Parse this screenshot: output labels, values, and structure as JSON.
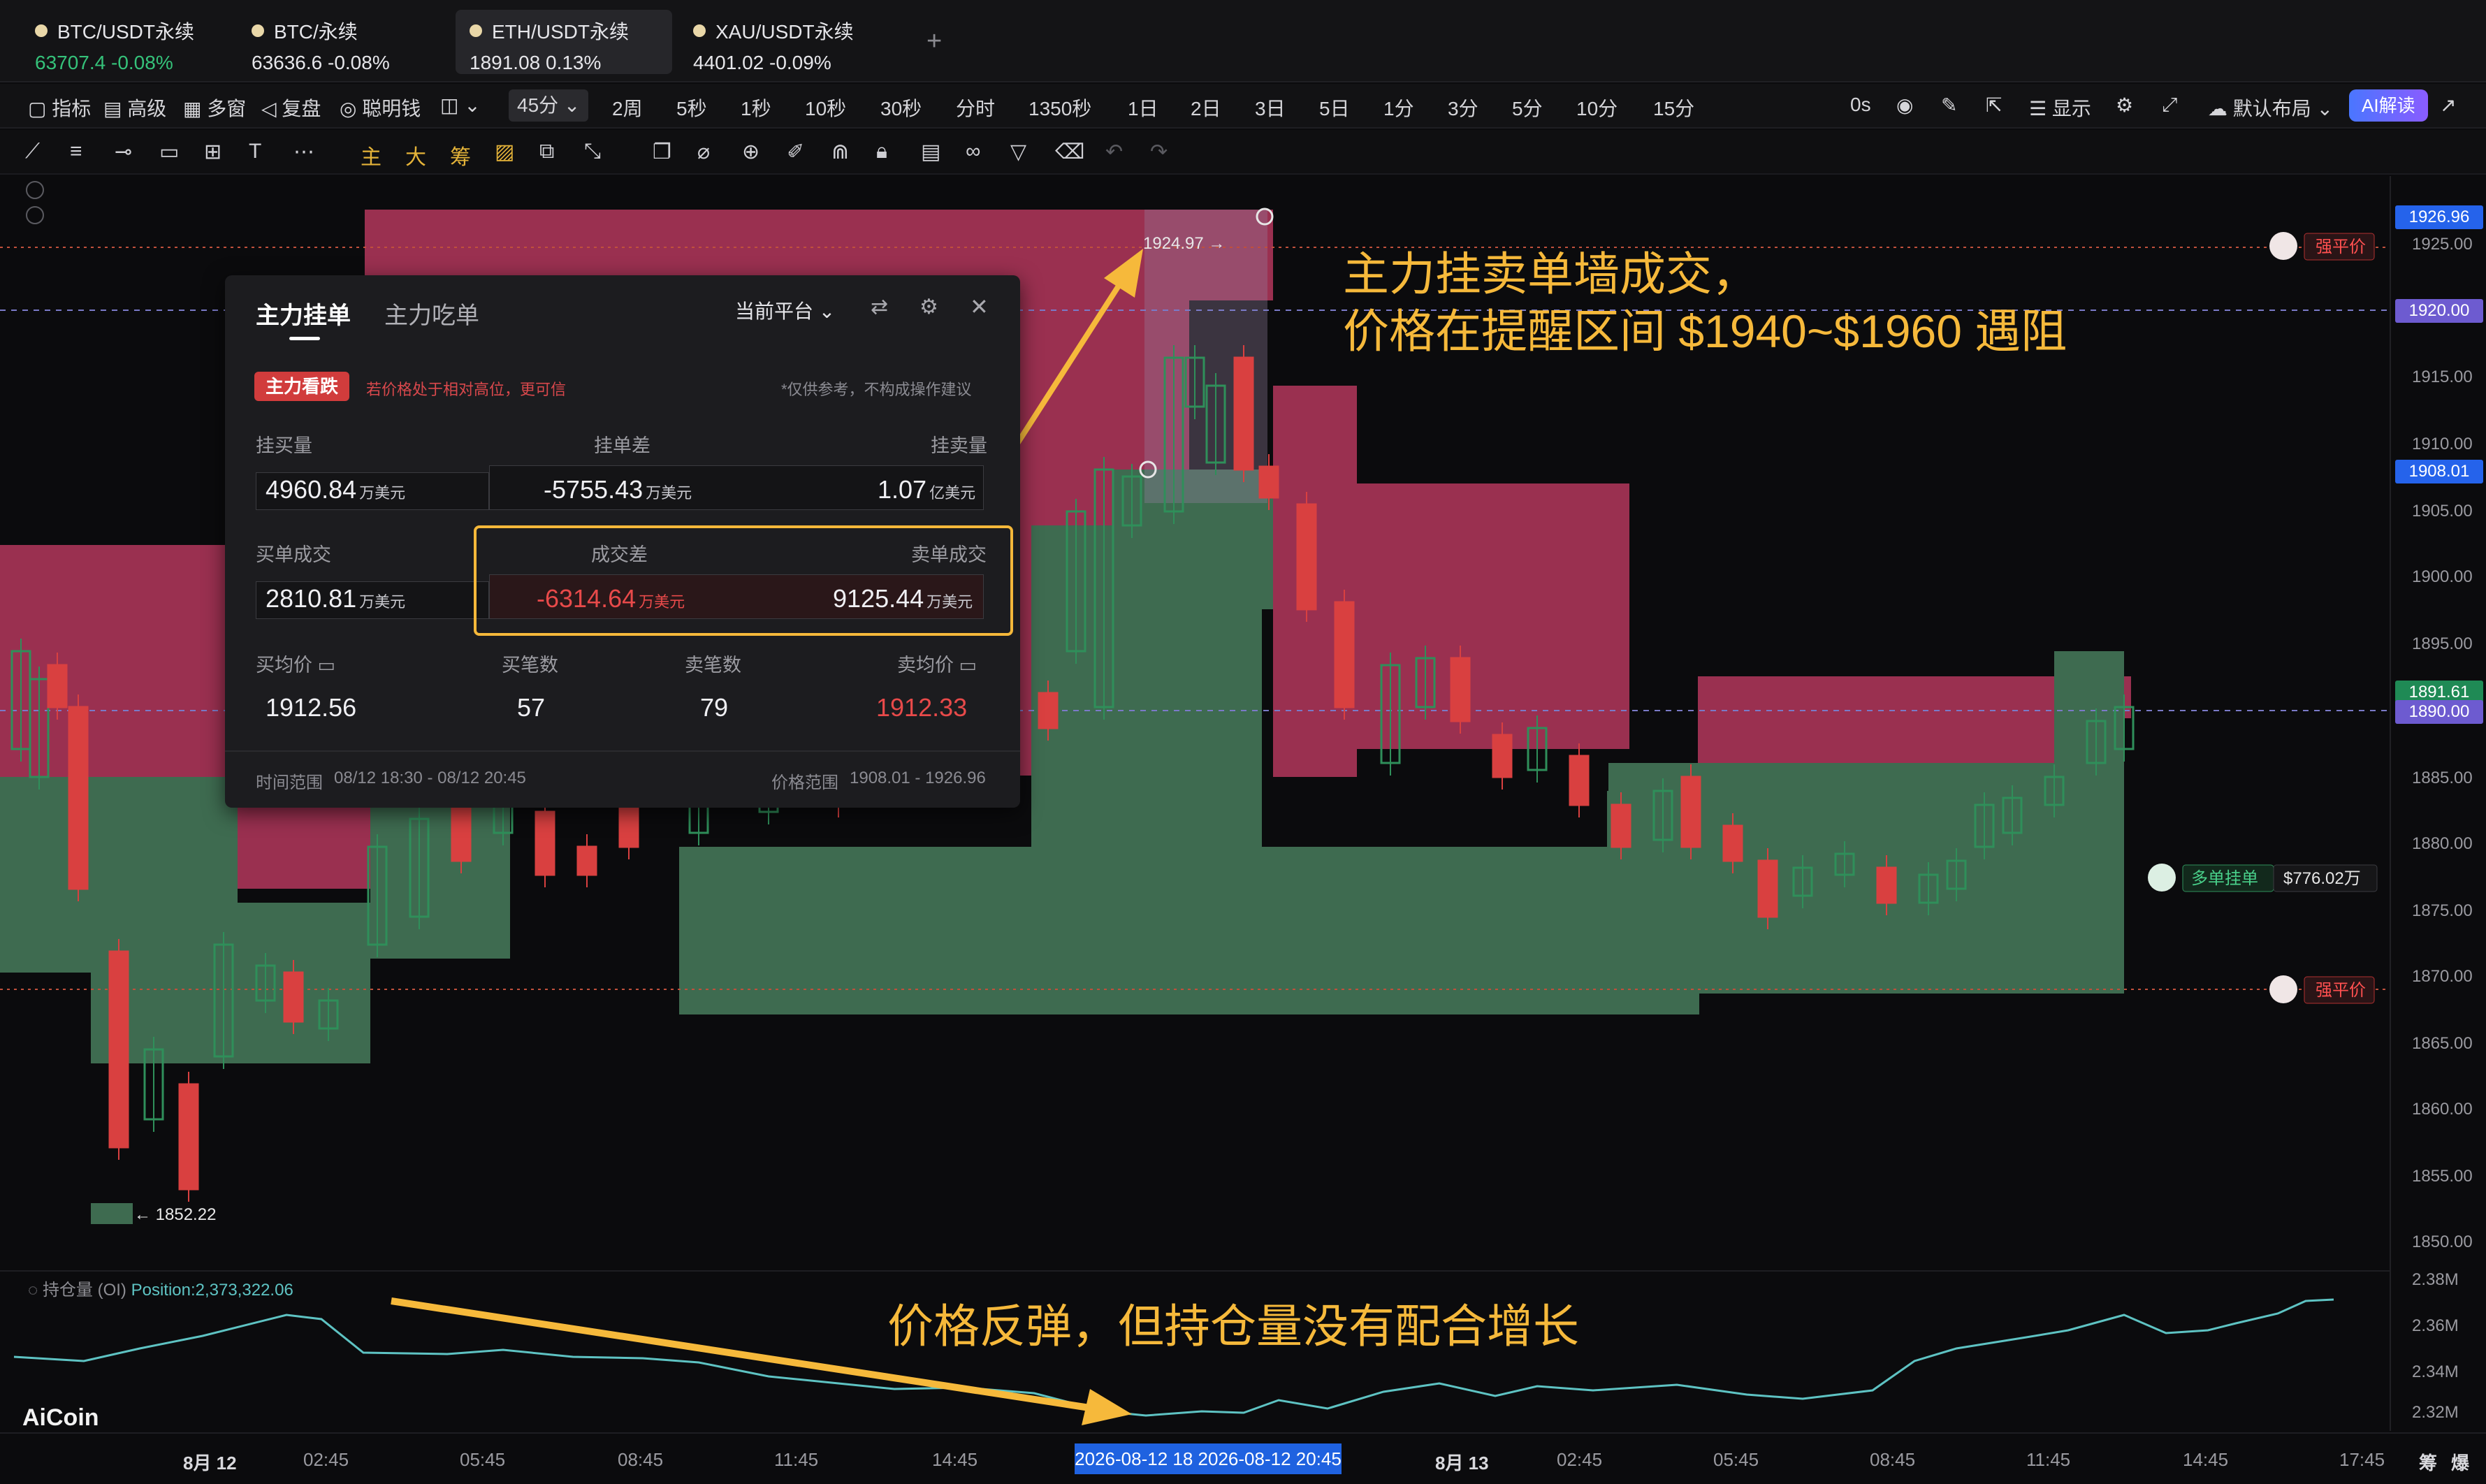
{
  "tabs": [
    {
      "symbol": "BTC/USDT永续",
      "price": "63707.4",
      "change": "-0.08%",
      "active": false
    },
    {
      "symbol": "BTC/永续",
      "price": "63636.6",
      "change": "-0.08%",
      "active": false
    },
    {
      "symbol": "ETH/USDT永续",
      "price": "1891.08",
      "change": "0.13%",
      "active": true
    },
    {
      "symbol": "XAU/USDT永续",
      "price": "4401.02",
      "change": "-0.09%",
      "active": false
    }
  ],
  "toolbar": {
    "indicators": "指标",
    "advanced": "高级",
    "multi_window": "多窗",
    "replay": "复盘",
    "smart_money": "聪明钱",
    "interval_selected": "45分",
    "intervals": [
      "2周",
      "5秒",
      "1秒",
      "10秒",
      "30秒",
      "分时",
      "1350秒",
      "1日",
      "2日",
      "3日",
      "5日",
      "1分",
      "3分",
      "5分",
      "10分",
      "15分"
    ],
    "countdown": "0s",
    "display": "显示",
    "layout": "默认布局",
    "ai": "AI解读"
  },
  "drawbar": {
    "tags": [
      "主",
      "大",
      "筹"
    ]
  },
  "chart": {
    "price_labels": [
      "1925.00",
      "1915.00",
      "1910.00",
      "1905.00",
      "1900.00",
      "1895.00",
      "1885.00",
      "1880.00",
      "1875.00",
      "1870.00",
      "1865.00",
      "1860.00",
      "1855.00",
      "1850.00"
    ],
    "price_badges": [
      {
        "text": "1926.96",
        "color": "#2563eb"
      },
      {
        "text": "1920.00",
        "color": "#6d5bd0"
      },
      {
        "text": "1908.01",
        "color": "#2563eb"
      },
      {
        "text": "1891.61",
        "color": "#1f8a55"
      },
      {
        "text": "1890.00",
        "color": "#6d5bd0"
      }
    ],
    "high_label": "1924.97 →",
    "low_label": "← 1852.22",
    "liq_price": "强平价",
    "buy_wall": {
      "label": "多单挂单",
      "value": "$776.02万"
    },
    "annotation_top_1": "主力挂卖单墙成交，",
    "annotation_top_2": "价格在提醒区间 $1940~$1960 遇阻",
    "annotation_bottom": "价格反弹，但持仓量没有配合增长",
    "colors": {
      "sell_wall": "#9a3050",
      "buy_wall": "#3e6b50",
      "candle_up": "#2f8f5a",
      "candle_down": "#d94040",
      "annotation": "#f6b93b"
    }
  },
  "panel": {
    "tab_active": "主力挂单",
    "tab_inactive": "主力吃单",
    "platform": "当前平台",
    "signal": "主力看跌",
    "signal_hint": "若价格处于相对高位，更可信",
    "disclaimer": "*仅供参考，不构成操作建议",
    "bid_volume_label": "挂买量",
    "diff_label": "挂单差",
    "ask_volume_label": "挂卖量",
    "bid_volume": "4960.84",
    "bid_volume_unit": "万美元",
    "diff": "-5755.43",
    "diff_unit": "万美元",
    "ask_volume": "1.07",
    "ask_volume_unit": "亿美元",
    "buy_fill_label": "买单成交",
    "fill_diff_label": "成交差",
    "sell_fill_label": "卖单成交",
    "buy_fill": "2810.81",
    "buy_fill_unit": "万美元",
    "fill_diff": "-6314.64",
    "fill_diff_unit": "万美元",
    "sell_fill": "9125.44",
    "sell_fill_unit": "万美元",
    "avg_buy_label": "买均价",
    "buy_count_label": "买笔数",
    "sell_count_label": "卖笔数",
    "avg_sell_label": "卖均价",
    "avg_buy": "1912.56",
    "buy_count": "57",
    "sell_count": "79",
    "avg_sell": "1912.33",
    "time_range_label": "时间范围",
    "time_range": "08/12 18:30 - 08/12 20:45",
    "price_range_label": "价格范围",
    "price_range": "1908.01 - 1926.96"
  },
  "oi": {
    "title": "持仓量 (OI)",
    "position": "Position:2,373,322.06",
    "axis": [
      "2.38M",
      "2.36M",
      "2.34M",
      "2.32M"
    ],
    "logo": "AiCoin"
  },
  "time_axis": {
    "labels": [
      "8月 12",
      "02:45",
      "05:45",
      "08:45",
      "11:45",
      "14:45",
      "8月 13",
      "02:45",
      "05:45",
      "08:45",
      "11:45",
      "14:45",
      "17:45"
    ],
    "cursor": "2026-08-12 18  2026-08-12 20:45",
    "right_tools": [
      "筹",
      "爆"
    ]
  }
}
